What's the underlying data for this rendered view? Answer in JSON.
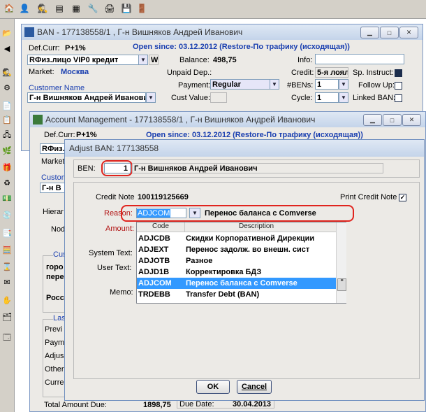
{
  "toolbar": {
    "icons": [
      "home-icon",
      "person-icon",
      "agent-icon",
      "list-icon",
      "grid-icon",
      "wrench-icon",
      "printer-icon",
      "exit-icon"
    ]
  },
  "leftbar": {
    "icons": [
      "folder-icon",
      "back-icon",
      "agent-icon",
      "gear-icon",
      "document-icon",
      "clipboard-icon",
      "network-icon",
      "tree-icon",
      "money-icon",
      "gift-icon",
      "recycle-icon",
      "people-icon",
      "arrow-icon",
      "disk-icon",
      "chart-icon",
      "calculator-icon",
      "report-icon",
      "hourglass-icon",
      "stamp-icon",
      "hand-icon",
      "layers-icon",
      "window-icon"
    ]
  },
  "ban_window": {
    "title": "BAN - 177138558/1 , Г-н Вишняков Андрей Иванович",
    "open_since": "Open since: 03.12.2012 (Restore-По трафику (исходящая))",
    "def_curr_label": "Def.Curr:",
    "def_curr": "P+1%",
    "account_type": "RФиз.лицо  VIP0  кредит",
    "w_label": "W",
    "market_label": "Market:",
    "market": "Москва",
    "customer_name_label": "Customer Name",
    "customer_name": "Г-н Вишняков Андрей Иванови",
    "balance_label": "Balance:",
    "balance": "498,75",
    "unpaid_label": "Unpaid Dep.:",
    "payment_label": "Payment:",
    "payment": "Regular",
    "cust_value_label": "Cust Value:",
    "info_label": "Info:",
    "credit_label": "Credit:",
    "credit": "5-я лоял",
    "sp_instruct_label": "Sp. Instruct:",
    "bens_label": "#BENs:",
    "bens": "1",
    "follow_up_label": "Follow Up:",
    "cycle_label": "Cycle:",
    "cycle": "1",
    "linked_ban_label": "Linked BAN:"
  },
  "acct_window": {
    "title": "Account Management - 177138558/1 , Г-н Вишняков Андрей Иванович",
    "def_curr_label": "Def.Curr:",
    "def_curr": "P+1%",
    "open_since": "Open since: 03.12.2012 (Restore-По трафику (исходящая))",
    "account_type": "RФиз.",
    "market_partial": "Market",
    "customer_partial": "Custom",
    "name_partial": "Г-н В",
    "hierarchy_partial": "Hierar",
    "node_partial": "Nod",
    "cust_group_partial": "Cus",
    "addr_lines": [
      "горо",
      "пере",
      "",
      "Росс"
    ],
    "last_group_partial": "Las",
    "left_items": [
      "Previ",
      "Paym",
      "Adjus",
      "Other",
      "Curre"
    ],
    "total_amount_label": "Total Amount Due:",
    "total_amount": "1898,75",
    "due_date_label": "Due Date:",
    "due_date": "30.04.2013"
  },
  "dialog": {
    "title": "Adjust BAN: 177138558",
    "ben_label": "BEN:",
    "ben": "1",
    "ben_name": "Г-н Вишняков Андрей Иванович",
    "credit_note_label": "Credit Note",
    "credit_note": "100119125669",
    "print_credit_note_label": "Print Credit Note",
    "reason_label": "Reason:",
    "reason_code": "ADJCOM",
    "reason_desc": "Перенос баланса с Comverse",
    "amount_label": "Amount:",
    "system_text_label": "System Text:",
    "user_text_label": "User Text:",
    "memo_label": "Memo:",
    "list_headers": [
      "Code",
      "Description"
    ],
    "list_rows": [
      {
        "code": "ADJCDB",
        "desc": "Скидки Корпоративной Дирекции"
      },
      {
        "code": "ADJEXT",
        "desc": "Перенос задолж. во внешн. сист"
      },
      {
        "code": "ADJOTB",
        "desc": "Разное"
      },
      {
        "code": "ADJD1B",
        "desc": "Корректировка БДЗ"
      },
      {
        "code": "ADJCOM",
        "desc": "Перенос баланса с Comverse"
      },
      {
        "code": "TRDEBB",
        "desc": "Transfer Debt (BAN)"
      }
    ],
    "ok_label": "OK",
    "cancel_label": "Cancel"
  }
}
